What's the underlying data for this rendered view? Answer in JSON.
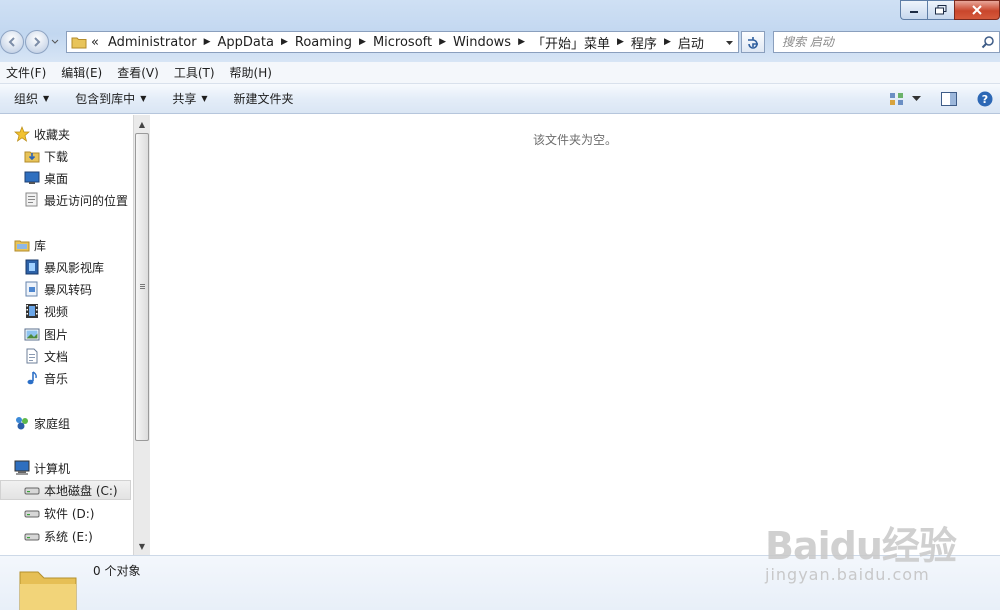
{
  "window": {
    "controls": {
      "minimize": "minimize",
      "maximize": "maximize",
      "close": "close"
    }
  },
  "address": {
    "overflow": "«",
    "crumbs": [
      "Administrator",
      "AppData",
      "Roaming",
      "Microsoft",
      "Windows",
      "「开始」菜单",
      "程序",
      "启动"
    ]
  },
  "search": {
    "placeholder": "搜索 启动"
  },
  "menu": [
    "文件(F)",
    "编辑(E)",
    "查看(V)",
    "工具(T)",
    "帮助(H)"
  ],
  "toolbar": {
    "organize": "组织",
    "include_library": "包含到库中",
    "share": "共享",
    "new_folder": "新建文件夹"
  },
  "nav": {
    "favorites": {
      "label": "收藏夹",
      "items": [
        "下载",
        "桌面",
        "最近访问的位置"
      ]
    },
    "libraries": {
      "label": "库",
      "items": [
        "暴风影视库",
        "暴风转码",
        "视频",
        "图片",
        "文档",
        "音乐"
      ]
    },
    "homegroup": {
      "label": "家庭组"
    },
    "computer": {
      "label": "计算机",
      "items": [
        "本地磁盘 (C:)",
        "软件 (D:)",
        "系统 (E:)"
      ]
    }
  },
  "content": {
    "empty_message": "该文件夹为空。"
  },
  "details": {
    "count": "0 个对象"
  },
  "watermark": {
    "logo": "Baidu经验",
    "url": "jingyan.baidu.com"
  },
  "colors": {
    "accent": "#3a6ea5",
    "close": "#c9462c",
    "folder": "#e8c45a"
  }
}
